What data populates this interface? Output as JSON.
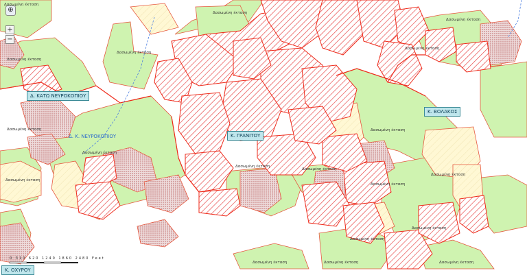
{
  "controls": {
    "pan": "⊕",
    "zoom_in": "+",
    "zoom_out": "−"
  },
  "towns": {
    "kato_nevrokopi": "Δ. ΚΑΤΩ ΝΕΥΡΟΚΟΠΙΟΥ",
    "granitou": "Κ. ΓΡΑΝΙΤΟΥ",
    "volakos": "Κ. ΒΟΛΑΚΟΣ",
    "ochyrou": "Κ. ΟΧΥΡΟΥ"
  },
  "municipality_label": "Δ. Κ. ΝΕΥΡΟΚΟΠΙΟΥ",
  "area_label": "Δασωμένη έκταση",
  "scale_bar": "0  310  620     1240     1860     2480 Feet",
  "colors": {
    "forest": "#cff3b0",
    "hatched": "#e84040",
    "dotted": "#b77a7a",
    "pale": "#fff7cf",
    "boundary": "#ee2a1a"
  }
}
